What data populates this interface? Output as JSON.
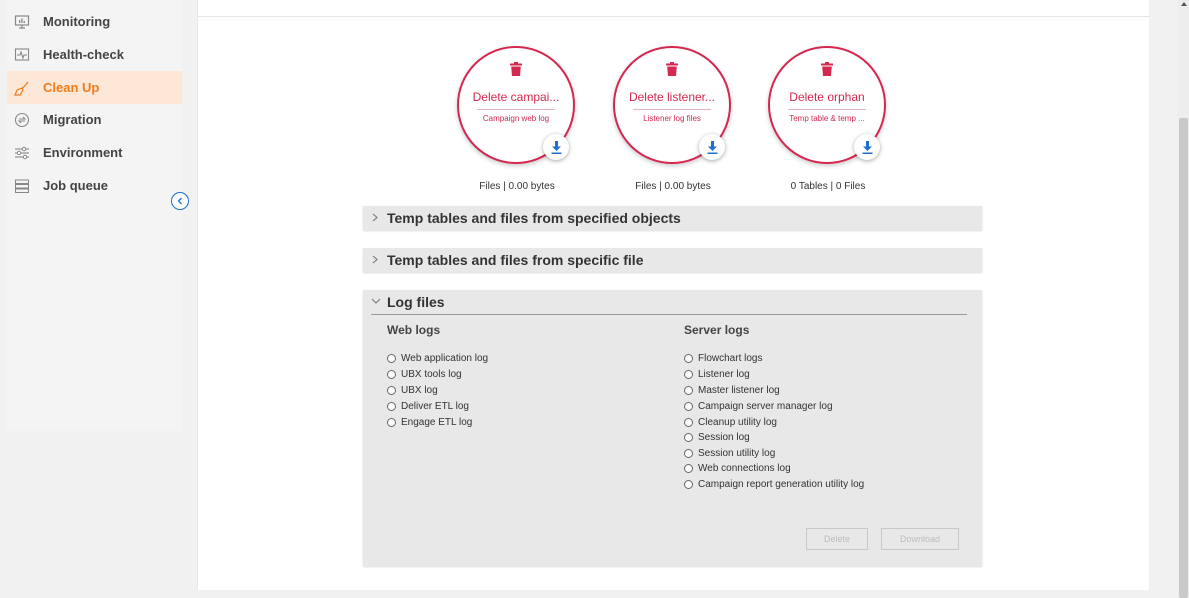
{
  "sidebar": {
    "items": [
      {
        "label": "Monitoring",
        "icon": "monitor-icon"
      },
      {
        "label": "Health-check",
        "icon": "heartbeat-icon"
      },
      {
        "label": "Clean Up",
        "icon": "broom-icon",
        "active": true
      },
      {
        "label": "Migration",
        "icon": "migration-icon"
      },
      {
        "label": "Environment",
        "icon": "sliders-icon"
      },
      {
        "label": "Job queue",
        "icon": "queue-icon"
      }
    ],
    "collapse_icon": "chevron-left-icon"
  },
  "cards": [
    {
      "title": "Delete campai...",
      "subtitle": "Campaign web log",
      "caption": "Files | 0.00 bytes"
    },
    {
      "title": "Delete listener...",
      "subtitle": "Listener log files",
      "caption": "Files | 0.00 bytes"
    },
    {
      "title": "Delete orphan",
      "subtitle": "Temp table & temp ...",
      "caption": "0 Tables | 0 Files"
    }
  ],
  "accordions": {
    "specified_objects": {
      "title": "Temp tables and files from specified objects",
      "expanded": false
    },
    "specific_file": {
      "title": "Temp tables and files from specific file",
      "expanded": false
    },
    "log_files": {
      "title": "Log files",
      "expanded": true
    }
  },
  "log_files": {
    "web_logs": {
      "title": "Web logs",
      "options": [
        "Web application log",
        "UBX tools log",
        "UBX log",
        "Deliver ETL log",
        "Engage ETL log"
      ]
    },
    "server_logs": {
      "title": "Server logs",
      "options": [
        "Flowchart logs",
        "Listener log",
        "Master listener log",
        "Campaign server manager log",
        "Cleanup utility log",
        "Session log",
        "Session utility log",
        "Web connections log",
        "Campaign report generation utility log"
      ]
    },
    "delete_label": "Delete",
    "download_label": "Download"
  },
  "colors": {
    "accent": "#d3284f",
    "active_nav": "#f07c1c",
    "active_nav_bg": "#fde7d6",
    "download_blue": "#1f6fd1"
  }
}
